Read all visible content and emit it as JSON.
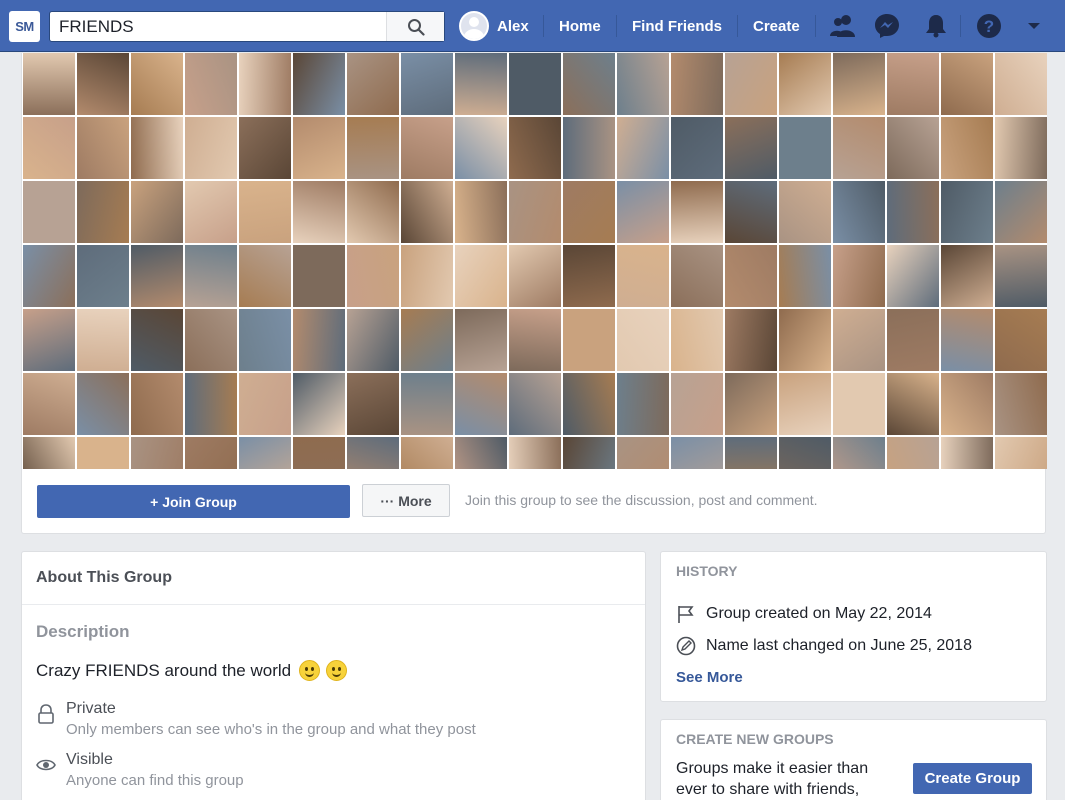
{
  "topbar": {
    "logo": "SM",
    "search_value": "FRIENDS",
    "user_name": "Alex",
    "nav": [
      "Home",
      "Find Friends",
      "Create"
    ]
  },
  "cover": {
    "join_label": "+ Join Group",
    "more_label": "··· More",
    "join_hint": "Join this group to see the discussion, post and comment.",
    "tile_colors": [
      "#8b6f5a",
      "#c9a27e",
      "#7a8fa6",
      "#b38b6d",
      "#e2c9b0",
      "#5e6c7b",
      "#a67c52",
      "#d9b38c",
      "#4f5b66",
      "#c7a08a",
      "#9e7b63",
      "#6d7f8c",
      "#e8d2bd",
      "#8f6b4e",
      "#b7a294",
      "#5a4636",
      "#cfae92",
      "#7d6a5b",
      "#a99383"
    ]
  },
  "about": {
    "title": "About This Group",
    "desc_title": "Description",
    "desc_text": "Crazy FRIENDS around the world",
    "private_title": "Private",
    "private_sub": "Only members can see who's in the group and what they post",
    "visible_title": "Visible",
    "visible_sub": "Anyone can find this group"
  },
  "history": {
    "title": "HISTORY",
    "created": "Group created on May 22, 2014",
    "renamed": "Name last changed on June 25, 2018",
    "see_more": "See More"
  },
  "create_groups": {
    "title": "CREATE NEW GROUPS",
    "text": "Groups make it easier than ever to share with friends,",
    "button": "Create Group"
  }
}
